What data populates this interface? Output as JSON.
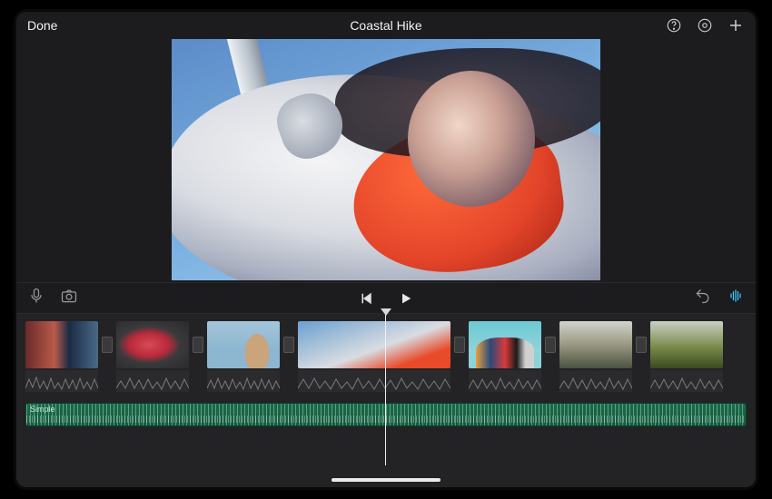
{
  "header": {
    "done_label": "Done",
    "title": "Coastal Hike"
  },
  "toolbar": {
    "mic_icon": "microphone-icon",
    "camera_icon": "camera-icon",
    "prev_icon": "skip-back-icon",
    "play_icon": "play-icon",
    "undo_icon": "undo-icon",
    "levels_icon": "audio-levels-icon"
  },
  "timeline": {
    "clips": [
      {
        "id": "clip-1",
        "desc": "indoor-portrait"
      },
      {
        "id": "clip-2",
        "desc": "red-leaf"
      },
      {
        "id": "clip-3",
        "desc": "woman-sky-profile"
      },
      {
        "id": "clip-4",
        "desc": "woman-puffer-jacket",
        "wide": true
      },
      {
        "id": "clip-5",
        "desc": "group-friends"
      },
      {
        "id": "clip-6",
        "desc": "plains-landscape"
      },
      {
        "id": "clip-7",
        "desc": "green-hills-path"
      }
    ],
    "audio_label": "Simple"
  }
}
